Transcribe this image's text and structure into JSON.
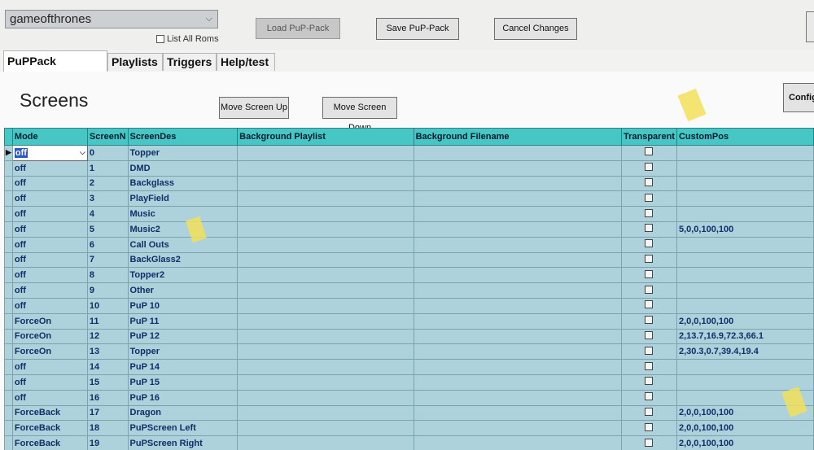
{
  "header": {
    "rom_select_value": "gameofthrones",
    "list_all_roms_label": "List All Roms",
    "load_label": "Load PuP-Pack",
    "save_label": "Save PuP-Pack",
    "cancel_label": "Cancel Changes"
  },
  "tabs": [
    {
      "label": "PuPPack Screens",
      "active": true
    },
    {
      "label": "Playlists"
    },
    {
      "label": "Triggers"
    },
    {
      "label": "Help/test"
    }
  ],
  "panel": {
    "heading": "Screens",
    "move_up_label": "Move Screen Up",
    "move_down_label": "Move Screen Down",
    "config_label": "Config"
  },
  "grid": {
    "columns": [
      "Mode",
      "ScreenN",
      "ScreenDes",
      "Background Playlist",
      "Background Filename",
      "Transparent",
      "CustomPos"
    ],
    "rows": [
      {
        "mode": "off",
        "num": "0",
        "des": "Topper",
        "custompos": ""
      },
      {
        "mode": "off",
        "num": "1",
        "des": "DMD",
        "custompos": ""
      },
      {
        "mode": "off",
        "num": "2",
        "des": "Backglass",
        "custompos": ""
      },
      {
        "mode": "off",
        "num": "3",
        "des": "PlayField",
        "custompos": ""
      },
      {
        "mode": "off",
        "num": "4",
        "des": "Music",
        "custompos": ""
      },
      {
        "mode": "off",
        "num": "5",
        "des": "Music2",
        "custompos": "5,0,0,100,100"
      },
      {
        "mode": "off",
        "num": "6",
        "des": "Call Outs",
        "custompos": ""
      },
      {
        "mode": "off",
        "num": "7",
        "des": "BackGlass2",
        "custompos": ""
      },
      {
        "mode": "off",
        "num": "8",
        "des": "Topper2",
        "custompos": ""
      },
      {
        "mode": "off",
        "num": "9",
        "des": "Other",
        "custompos": ""
      },
      {
        "mode": "off",
        "num": "10",
        "des": "PuP 10",
        "custompos": ""
      },
      {
        "mode": "ForceOn",
        "num": "11",
        "des": "PuP 11",
        "custompos": "2,0,0,100,100"
      },
      {
        "mode": "ForceOn",
        "num": "12",
        "des": "PuP 12",
        "custompos": "2,13.7,16.9,72.3,66.1"
      },
      {
        "mode": "ForceOn",
        "num": "13",
        "des": "Topper",
        "custompos": "2,30.3,0.7,39.4,19.4"
      },
      {
        "mode": "off",
        "num": "14",
        "des": "PuP 14",
        "custompos": ""
      },
      {
        "mode": "off",
        "num": "15",
        "des": "PuP 15",
        "custompos": ""
      },
      {
        "mode": "off",
        "num": "16",
        "des": "PuP 16",
        "custompos": ""
      },
      {
        "mode": "ForceBack",
        "num": "17",
        "des": "Dragon",
        "custompos": "2,0,0,100,100"
      },
      {
        "mode": "ForceBack",
        "num": "18",
        "des": "PuPScreen Left",
        "custompos": "2,0,0,100,100"
      },
      {
        "mode": "ForceBack",
        "num": "19",
        "des": "PuPScreen Right",
        "custompos": "2,0,0,100,100"
      }
    ]
  },
  "icons": {
    "row_indicator": "triangle-right",
    "dropdown": "chevron-down"
  }
}
